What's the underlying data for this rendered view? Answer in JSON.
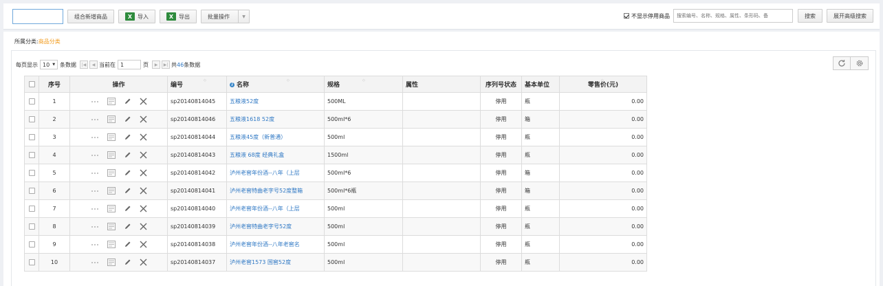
{
  "toolbar": {
    "combo_new_label": "组合新增商品",
    "import_label": "导入",
    "export_label": "导出",
    "batch_label": "批量操作",
    "hide_disabled_label": "不显示停用商品",
    "search_placeholder": "搜索编号、名称、规格、属性、条形码、备",
    "search_label": "搜索",
    "advanced_label": "展开高级搜索",
    "hide_disabled_checked": true
  },
  "category": {
    "label": "所属分类:",
    "value": "商品分类"
  },
  "pager": {
    "per_page_label": "每页显示",
    "per_page_value": "10",
    "rows_label": "条数据",
    "current_label": "当前在",
    "current_page": "1",
    "page_label": "页",
    "total_prefix": "共",
    "total_count": "46",
    "total_suffix": "条数据"
  },
  "table": {
    "headers": {
      "index": "序号",
      "ops": "操作",
      "code": "编号",
      "name": "名称",
      "spec": "规格",
      "attr": "属性",
      "serial_status": "序列号状态",
      "unit": "基本单位",
      "price": "零售价(元)"
    },
    "rows": [
      {
        "index": "1",
        "code": "sp20140814045",
        "name": "五粮液52度",
        "spec": "500ML",
        "attr": "",
        "serial_status": "停用",
        "unit": "瓶",
        "price": "0.00"
      },
      {
        "index": "2",
        "code": "sp20140814046",
        "name": "五粮液1618 52度",
        "spec": "500ml*6",
        "attr": "",
        "serial_status": "停用",
        "unit": "箱",
        "price": "0.00"
      },
      {
        "index": "3",
        "code": "sp20140814044",
        "name": "五粮液45度（新普通）",
        "spec": "500ml",
        "attr": "",
        "serial_status": "停用",
        "unit": "瓶",
        "price": "0.00"
      },
      {
        "index": "4",
        "code": "sp20140814043",
        "name": "五粮液 68度 经典礼盒",
        "spec": "1500ml",
        "attr": "",
        "serial_status": "停用",
        "unit": "瓶",
        "price": "0.00"
      },
      {
        "index": "5",
        "code": "sp20140814042",
        "name": "泸州老窖年份酒--八年（上层",
        "spec": "500ml*6",
        "attr": "",
        "serial_status": "停用",
        "unit": "箱",
        "price": "0.00"
      },
      {
        "index": "6",
        "code": "sp20140814041",
        "name": "泸州老窖特曲老字号52度整箱",
        "spec": "500ml*6瓶",
        "attr": "",
        "serial_status": "停用",
        "unit": "箱",
        "price": "0.00"
      },
      {
        "index": "7",
        "code": "sp20140814040",
        "name": "泸州老窖年份酒--八年（上层",
        "spec": "500ml",
        "attr": "",
        "serial_status": "停用",
        "unit": "瓶",
        "price": "0.00"
      },
      {
        "index": "8",
        "code": "sp20140814039",
        "name": "泸州老窖特曲老字号52度",
        "spec": "500ml",
        "attr": "",
        "serial_status": "停用",
        "unit": "瓶",
        "price": "0.00"
      },
      {
        "index": "9",
        "code": "sp20140814038",
        "name": "泸州老窖年份酒--八年老窖名",
        "spec": "500ml",
        "attr": "",
        "serial_status": "停用",
        "unit": "瓶",
        "price": "0.00"
      },
      {
        "index": "10",
        "code": "sp20140814037",
        "name": "泸州老窖1573 国窖52度",
        "spec": "500ml",
        "attr": "",
        "serial_status": "停用",
        "unit": "瓶",
        "price": "0.00"
      }
    ]
  },
  "icons": {
    "import": "excel-import-icon",
    "export": "excel-export-icon",
    "refresh": "refresh-icon",
    "settings": "gear-icon",
    "row_more": "ellipsis-icon",
    "row_detail": "card-icon",
    "row_edit": "pencil-icon",
    "row_delete": "close-icon"
  },
  "colors": {
    "accent_link": "#2f78c4",
    "category_value": "#f29b1d",
    "excel_green": "#2e8b3d"
  }
}
